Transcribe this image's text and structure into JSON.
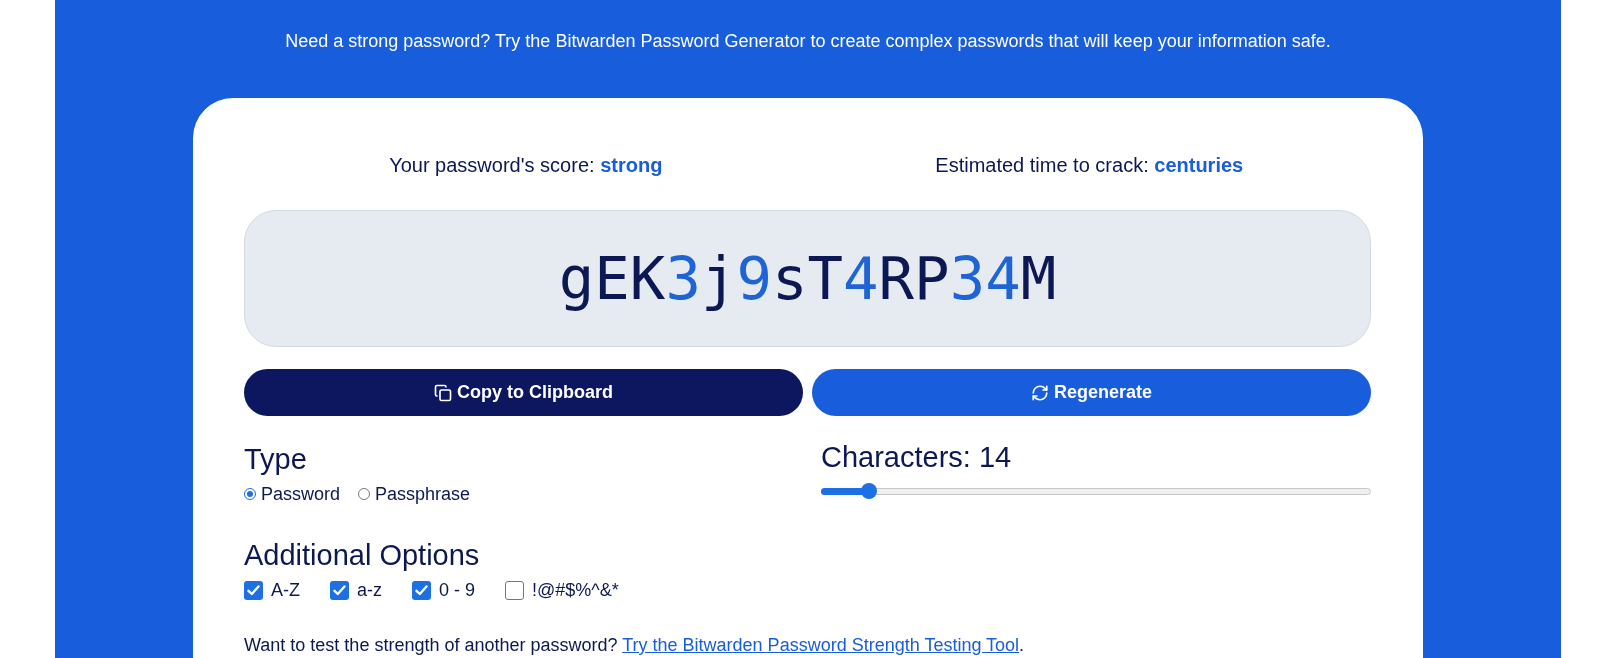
{
  "intro": "Need a strong password? Try the Bitwarden Password Generator to create complex passwords that will keep your information safe.",
  "stats": [
    "Your password's score: **strong**",
    "Estimated time to crack: **centuries**"
  ],
  "password": "gEK3j9sT4RP34M",
  "buttons": [
    {
      "label": "Copy to Clipboard",
      "kind": "copy"
    },
    {
      "label": "Regenerate",
      "kind": "regenerate"
    }
  ],
  "type": {
    "title": "Type",
    "options": [
      {
        "label": "Password",
        "selected": true
      },
      {
        "label": "Passphrase",
        "selected": false
      }
    ]
  },
  "length": {
    "label": "Characters: 14",
    "level": 0.085
  },
  "options": {
    "title": "Additional Options",
    "items": [
      {
        "label": "A-Z",
        "checked": true
      },
      {
        "label": "a-z",
        "checked": true
      },
      {
        "label": "0 - 9",
        "checked": true
      },
      {
        "label": "!@#$%^&*",
        "checked": false
      }
    ]
  },
  "footer": {
    "text": "Want to test the strength of another password?",
    "link": "Try the Bitwarden Password Strength Testing Tool",
    "end": "."
  }
}
